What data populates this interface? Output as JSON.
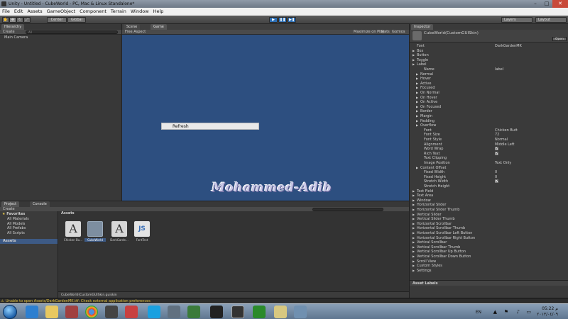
{
  "window": {
    "title": "Unity - Untitled - CubeWorld - PC, Mac & Linux Standalone*",
    "buttons": [
      "–",
      "□",
      "✕"
    ]
  },
  "menu": [
    "File",
    "Edit",
    "Assets",
    "GameObject",
    "Component",
    "Terrain",
    "Window",
    "Help"
  ],
  "toolbar": {
    "pivot_label": "Center",
    "space_label": "Global",
    "layers_label": "Layers",
    "layout_label": "Layout"
  },
  "hierarchy": {
    "tab": "Hierarchy",
    "create_label": "Create",
    "search_text": "All",
    "items": [
      "Main Camera"
    ]
  },
  "game": {
    "tabs": [
      "Scene",
      "Game"
    ],
    "aspect_label": "Free Aspect",
    "options": [
      "Maximize on Play",
      "Stats",
      "Gizmos"
    ],
    "refresh_button": "Refresh",
    "watermark": "Mohammed-Adib"
  },
  "inspector": {
    "tab": "Inspector",
    "object_name": "CubeWorld(CustomGUISkin)",
    "open_button": "Open",
    "rows": [
      {
        "label": "Font",
        "value": "DarkGardenMK",
        "indent": 0,
        "arrow": false,
        "check": false
      },
      {
        "label": "Box",
        "value": "",
        "indent": 0,
        "arrow": true,
        "check": false
      },
      {
        "label": "Button",
        "value": "",
        "indent": 0,
        "arrow": true,
        "check": false
      },
      {
        "label": "Toggle",
        "value": "",
        "indent": 0,
        "arrow": true,
        "check": false
      },
      {
        "label": "Label",
        "value": "",
        "indent": 0,
        "arrow": true,
        "check": false
      },
      {
        "label": "Name",
        "value": "label",
        "indent": 2,
        "arrow": false,
        "check": false
      },
      {
        "label": "Normal",
        "value": "",
        "indent": 1,
        "arrow": true,
        "check": false
      },
      {
        "label": "Hover",
        "value": "",
        "indent": 1,
        "arrow": true,
        "check": false
      },
      {
        "label": "Active",
        "value": "",
        "indent": 1,
        "arrow": true,
        "check": false
      },
      {
        "label": "Focused",
        "value": "",
        "indent": 1,
        "arrow": true,
        "check": false
      },
      {
        "label": "On Normal",
        "value": "",
        "indent": 1,
        "arrow": true,
        "check": false
      },
      {
        "label": "On Hover",
        "value": "",
        "indent": 1,
        "arrow": true,
        "check": false
      },
      {
        "label": "On Active",
        "value": "",
        "indent": 1,
        "arrow": true,
        "check": false
      },
      {
        "label": "On Focused",
        "value": "",
        "indent": 1,
        "arrow": true,
        "check": false
      },
      {
        "label": "Border",
        "value": "",
        "indent": 1,
        "arrow": true,
        "check": false
      },
      {
        "label": "Margin",
        "value": "",
        "indent": 1,
        "arrow": true,
        "check": false
      },
      {
        "label": "Padding",
        "value": "",
        "indent": 1,
        "arrow": true,
        "check": false
      },
      {
        "label": "Overflow",
        "value": "",
        "indent": 1,
        "arrow": true,
        "check": false
      },
      {
        "label": "Font",
        "value": "Chicken Butt",
        "indent": 2,
        "arrow": false,
        "check": false
      },
      {
        "label": "Font Size",
        "value": "72",
        "indent": 2,
        "arrow": false,
        "check": false
      },
      {
        "label": "Font Style",
        "value": "Normal",
        "indent": 2,
        "arrow": false,
        "check": false
      },
      {
        "label": "Alignment",
        "value": "Middle Left",
        "indent": 2,
        "arrow": false,
        "check": false
      },
      {
        "label": "Word Wrap",
        "value": "",
        "indent": 2,
        "arrow": false,
        "check": true
      },
      {
        "label": "Rich Text",
        "value": "",
        "indent": 2,
        "arrow": false,
        "check": true
      },
      {
        "label": "Text Clipping",
        "value": "",
        "indent": 2,
        "arrow": false,
        "check": false
      },
      {
        "label": "Image Position",
        "value": "Text Only",
        "indent": 2,
        "arrow": false,
        "check": false
      },
      {
        "label": "Content Offset",
        "value": "",
        "indent": 1,
        "arrow": true,
        "check": false
      },
      {
        "label": "Fixed Width",
        "value": "0",
        "indent": 2,
        "arrow": false,
        "check": false
      },
      {
        "label": "Fixed Height",
        "value": "0",
        "indent": 2,
        "arrow": false,
        "check": false
      },
      {
        "label": "Stretch Width",
        "value": "",
        "indent": 2,
        "arrow": false,
        "check": true
      },
      {
        "label": "Stretch Height",
        "value": "",
        "indent": 2,
        "arrow": false,
        "check": false
      },
      {
        "label": "Text Field",
        "value": "",
        "indent": 0,
        "arrow": true,
        "check": false
      },
      {
        "label": "Text Area",
        "value": "",
        "indent": 0,
        "arrow": true,
        "check": false
      },
      {
        "label": "Window",
        "value": "",
        "indent": 0,
        "arrow": true,
        "check": false
      },
      {
        "label": "Horizontal Slider",
        "value": "",
        "indent": 0,
        "arrow": true,
        "check": false
      },
      {
        "label": "Horizontal Slider Thumb",
        "value": "",
        "indent": 0,
        "arrow": true,
        "check": false
      },
      {
        "label": "Vertical Slider",
        "value": "",
        "indent": 0,
        "arrow": true,
        "check": false
      },
      {
        "label": "Vertical Slider Thumb",
        "value": "",
        "indent": 0,
        "arrow": true,
        "check": false
      },
      {
        "label": "Horizontal Scrollbar",
        "value": "",
        "indent": 0,
        "arrow": true,
        "check": false
      },
      {
        "label": "Horizontal Scrollbar Thumb",
        "value": "",
        "indent": 0,
        "arrow": true,
        "check": false
      },
      {
        "label": "Horizontal Scrollbar Left Button",
        "value": "",
        "indent": 0,
        "arrow": true,
        "check": false
      },
      {
        "label": "Horizontal Scrollbar Right Button",
        "value": "",
        "indent": 0,
        "arrow": true,
        "check": false
      },
      {
        "label": "Vertical Scrollbar",
        "value": "",
        "indent": 0,
        "arrow": true,
        "check": false
      },
      {
        "label": "Vertical Scrollbar Thumb",
        "value": "",
        "indent": 0,
        "arrow": true,
        "check": false
      },
      {
        "label": "Vertical Scrollbar Up Button",
        "value": "",
        "indent": 0,
        "arrow": true,
        "check": false
      },
      {
        "label": "Vertical Scrollbar Down Button",
        "value": "",
        "indent": 0,
        "arrow": true,
        "check": false
      },
      {
        "label": "Scroll View",
        "value": "",
        "indent": 0,
        "arrow": true,
        "check": false
      },
      {
        "label": "Custom Styles",
        "value": "",
        "indent": 0,
        "arrow": true,
        "check": false
      },
      {
        "label": "Settings",
        "value": "",
        "indent": 0,
        "arrow": true,
        "check": false
      }
    ],
    "asset_labels": "Asset Labels"
  },
  "project": {
    "tabs": [
      "Project",
      "Console"
    ],
    "create_label": "Create",
    "favorites_label": "Favorites",
    "favorites": [
      "All Materials",
      "All Models",
      "All Prefabs",
      "All Scripts"
    ],
    "assets_label": "Assets",
    "assets_header": "Assets",
    "assets": [
      {
        "name": "Chicken Bu...",
        "kind": "font"
      },
      {
        "name": "CubeWorld",
        "kind": "skin"
      },
      {
        "name": "DarkGarde...",
        "kind": "font"
      },
      {
        "name": "FontTest",
        "kind": "script"
      }
    ],
    "selected_path": "CubeWorld(CustomGUISkin.guiskin"
  },
  "status": {
    "message": "Unable to open Assets/DarkGardenMK.ttf: Check external application preferences"
  },
  "taskbar": {
    "language": "EN",
    "time": "05:22 م",
    "date": "٢٠١٣/٠٤/٠٩"
  },
  "colors": {
    "game_bg": "#2d4f80",
    "play_blue": "#2d6fb5",
    "status_warning": "#e0c040"
  }
}
